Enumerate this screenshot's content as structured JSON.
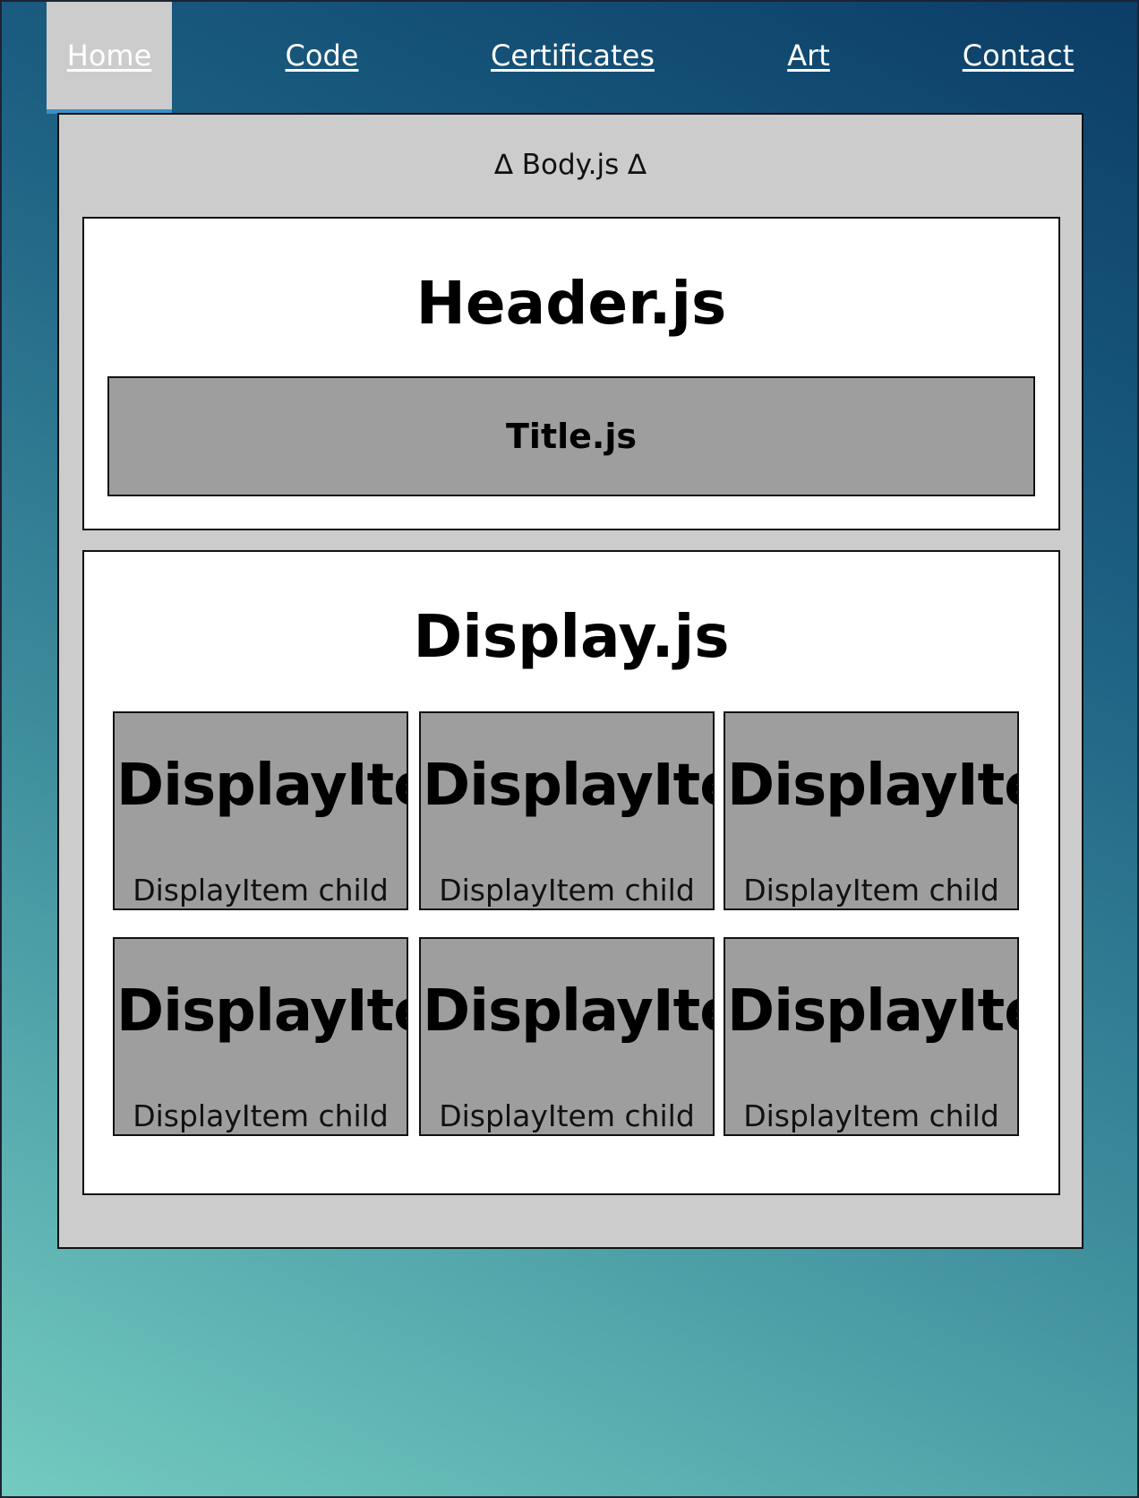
{
  "nav": {
    "items": [
      {
        "label": "Home",
        "active": true
      },
      {
        "label": "Code"
      },
      {
        "label": "Certificates"
      },
      {
        "label": "Art"
      },
      {
        "label": "Contact"
      }
    ]
  },
  "body": {
    "title": "∆ Body.js ∆",
    "header": {
      "title": "Header.js",
      "title_component": "Title.js"
    },
    "display": {
      "title": "Display.js",
      "items": [
        {
          "title": "DisplayItem",
          "child": "DisplayItem child"
        },
        {
          "title": "DisplayItem",
          "child": "DisplayItem child"
        },
        {
          "title": "DisplayItem",
          "child": "DisplayItem child"
        },
        {
          "title": "DisplayItem",
          "child": "DisplayItem child"
        },
        {
          "title": "DisplayItem",
          "child": "DisplayItem child"
        },
        {
          "title": "DisplayItem",
          "child": "DisplayItem child"
        }
      ]
    }
  },
  "colors": {
    "panel": "#cccccc",
    "item": "#9e9e9e",
    "active_nav_underline": "#3a8fc7"
  }
}
